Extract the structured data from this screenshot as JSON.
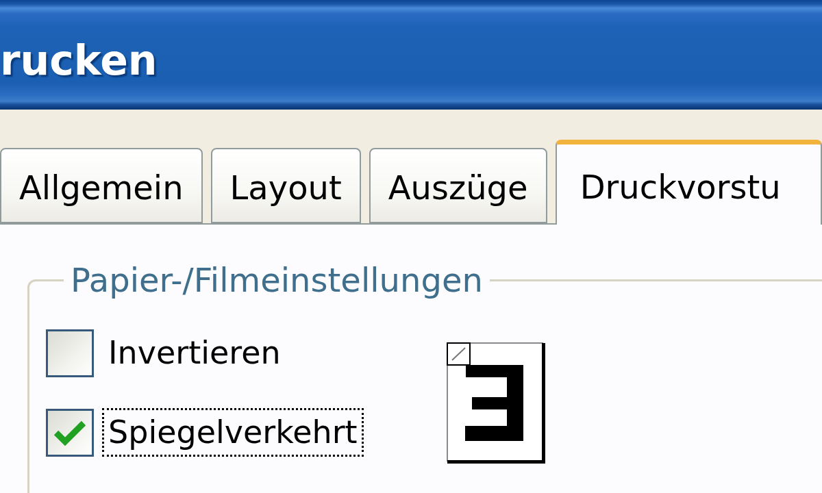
{
  "window": {
    "title": "rucken"
  },
  "tabs": [
    {
      "label": "Allgemein",
      "selected": false
    },
    {
      "label": "Layout",
      "selected": false
    },
    {
      "label": "Auszüge",
      "selected": false
    },
    {
      "label": "Druckvorstu",
      "selected": true
    }
  ],
  "group": {
    "title": "Papier-/Filmeinstellungen",
    "options": [
      {
        "label": "Invertieren",
        "checked": false,
        "focused": false
      },
      {
        "label": "Spiegelverkehrt",
        "checked": true,
        "focused": true
      }
    ]
  }
}
